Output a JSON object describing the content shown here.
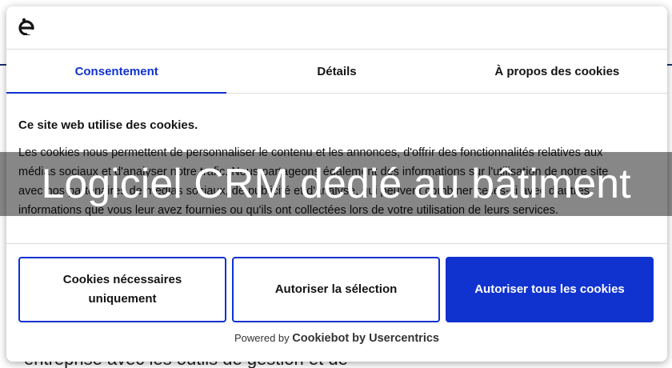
{
  "background_page": {
    "partial_text": "entreprise avec les outils de gestion et de"
  },
  "dialog": {
    "logo_icon": "cookiebot-logo-icon",
    "tabs": [
      {
        "label": "Consentement",
        "active": true
      },
      {
        "label": "Détails",
        "active": false
      },
      {
        "label": "À propos des cookies",
        "active": false
      }
    ],
    "title": "Ce site web utilise des cookies.",
    "description": "Les cookies nous permettent de personnaliser le contenu et les annonces, d'offrir des fonctionnalités relatives aux médias sociaux et d'analyser notre trafic. Nous partageons également des informations sur l'utilisation de notre site avec nos partenaires de médias sociaux, de publicité et d'analyse, qui peuvent combiner celles-ci avec d'autres informations que vous leur avez fournies ou qu'ils ont collectées lors de votre utilisation de leurs services.",
    "buttons": {
      "necessary": "Cookies nécessaires uniquement",
      "selection": "Autoriser la sélection",
      "all": "Autoriser tous les cookies"
    },
    "powered_by": "Powered by",
    "powered_brand": "Cookiebot by Usercentrics"
  },
  "banner": {
    "title": "Logiciel CRM dédié au bâtiment"
  },
  "colors": {
    "accent": "#1032cf",
    "banner_overlay": "rgba(0,0,0,0.47)"
  }
}
